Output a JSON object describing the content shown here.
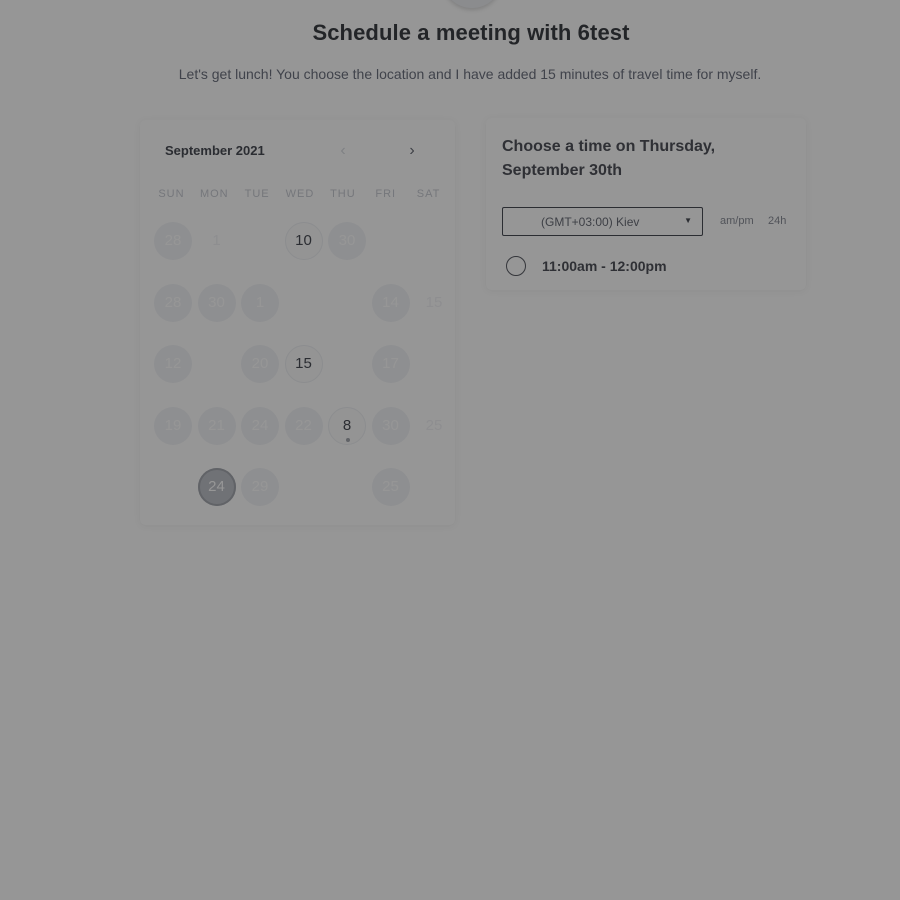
{
  "header": {
    "title": "Schedule a meeting with 6test",
    "subtitle": "Let's get lunch! You choose the location and I have added 15 minutes of travel time for myself."
  },
  "calendar": {
    "month_label": "September 2021",
    "prev_icon": "chevron-left-icon",
    "next_icon": "chevron-right-icon",
    "weekdays": [
      "SUN",
      "MON",
      "TUE",
      "WED",
      "THU",
      "FRI",
      "SAT"
    ],
    "days": [
      {
        "label": "28",
        "col": 0,
        "row": 0,
        "state": "avail"
      },
      {
        "label": "1",
        "col": 1,
        "row": 0,
        "state": "plain"
      },
      {
        "label": "10",
        "col": 3,
        "row": 0,
        "state": "today"
      },
      {
        "label": "30",
        "col": 4,
        "row": 0,
        "state": "avail"
      },
      {
        "label": "28",
        "col": 0,
        "row": 1,
        "state": "avail"
      },
      {
        "label": "30",
        "col": 1,
        "row": 1,
        "state": "avail"
      },
      {
        "label": "1",
        "col": 2,
        "row": 1,
        "state": "avail"
      },
      {
        "label": "14",
        "col": 5,
        "row": 1,
        "state": "avail"
      },
      {
        "label": "15",
        "col": 6,
        "row": 1,
        "state": "plain"
      },
      {
        "label": "12",
        "col": 0,
        "row": 2,
        "state": "avail"
      },
      {
        "label": "20",
        "col": 2,
        "row": 2,
        "state": "avail"
      },
      {
        "label": "15",
        "col": 3,
        "row": 2,
        "state": "today"
      },
      {
        "label": "17",
        "col": 5,
        "row": 2,
        "state": "avail"
      },
      {
        "label": "19",
        "col": 0,
        "row": 3,
        "state": "avail"
      },
      {
        "label": "21",
        "col": 1,
        "row": 3,
        "state": "avail"
      },
      {
        "label": "24",
        "col": 2,
        "row": 3,
        "state": "avail"
      },
      {
        "label": "22",
        "col": 3,
        "row": 3,
        "state": "avail"
      },
      {
        "label": "8",
        "col": 4,
        "row": 3,
        "state": "today",
        "dot": true
      },
      {
        "label": "30",
        "col": 5,
        "row": 3,
        "state": "avail"
      },
      {
        "label": "25",
        "col": 6,
        "row": 3,
        "state": "plain"
      },
      {
        "label": "24",
        "col": 1,
        "row": 4,
        "state": "selected"
      },
      {
        "label": "29",
        "col": 2,
        "row": 4,
        "state": "avail"
      },
      {
        "label": "25",
        "col": 5,
        "row": 4,
        "state": "avail"
      }
    ]
  },
  "times": {
    "heading": "Choose a time on Thursday, September 30th",
    "timezone": "(GMT+03:00) Kiev",
    "format_ampm": "am/pm",
    "format_24h": "24h",
    "slots": [
      {
        "label": "11:00am - 12:00pm"
      }
    ]
  },
  "colors": {
    "overlay": "#959595",
    "selected_day": "#bfc2c9",
    "available_day": "#f2f3f6"
  }
}
